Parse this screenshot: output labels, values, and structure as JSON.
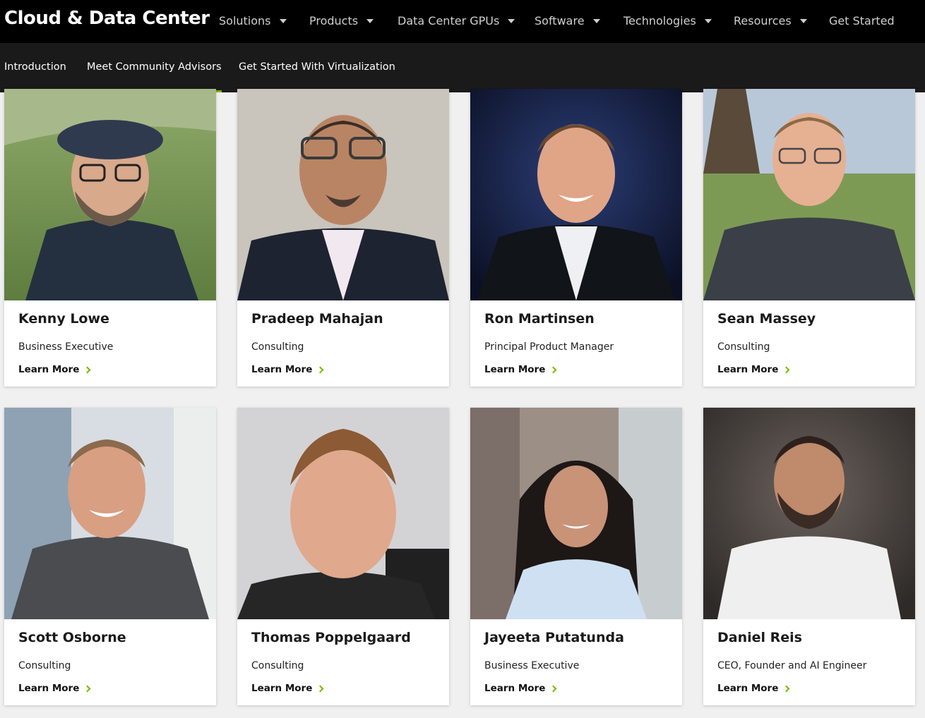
{
  "header": {
    "brand": "Cloud & Data Center",
    "nav": [
      {
        "label": "Solutions",
        "has_menu": true
      },
      {
        "label": "Products",
        "has_menu": true
      },
      {
        "label": "Data Center GPUs",
        "has_menu": true
      },
      {
        "label": "Software",
        "has_menu": true
      },
      {
        "label": "Technologies",
        "has_menu": true
      },
      {
        "label": "Resources",
        "has_menu": true
      },
      {
        "label": "Get Started",
        "has_menu": false
      }
    ]
  },
  "subnav": {
    "tabs": [
      {
        "label": "Introduction",
        "active": false
      },
      {
        "label": "Meet Community Advisors",
        "active": true
      },
      {
        "label": "Get Started With Virtualization",
        "active": false
      }
    ]
  },
  "accent_color": "#76b900",
  "advisors": [
    {
      "name": "Kenny Lowe",
      "role": "Business Executive",
      "link": "Learn More"
    },
    {
      "name": "Pradeep Mahajan",
      "role": "Consulting",
      "link": "Learn More"
    },
    {
      "name": "Ron Martinsen",
      "role": "Principal Product Manager",
      "link": "Learn More"
    },
    {
      "name": "Sean Massey",
      "role": "Consulting",
      "link": "Learn More"
    },
    {
      "name": "Scott Osborne",
      "role": "Consulting",
      "link": "Learn More"
    },
    {
      "name": "Thomas Poppelgaard",
      "role": "Consulting",
      "link": "Learn More"
    },
    {
      "name": "Jayeeta Putatunda",
      "role": "Business Executive",
      "link": "Learn More"
    },
    {
      "name": "Daniel Reis",
      "role": "CEO, Founder and AI Engineer",
      "link": "Learn More"
    }
  ]
}
